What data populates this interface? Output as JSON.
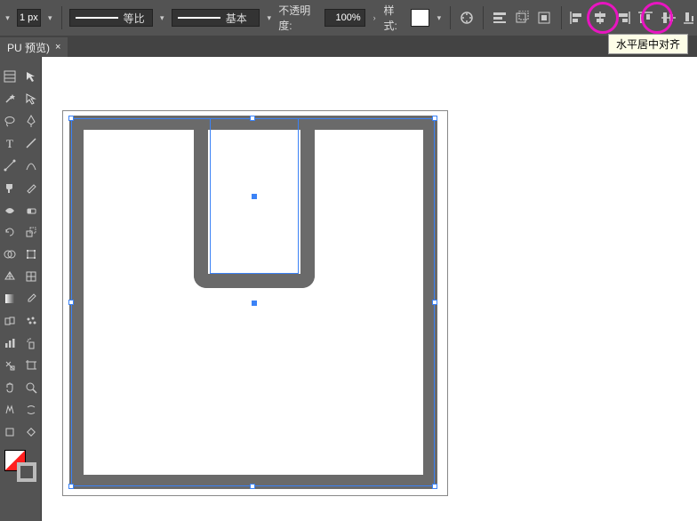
{
  "toolbar": {
    "stroke_value": "1 px",
    "dash_label": "等比",
    "profile_label": "基本",
    "opacity_label": "不透明度:",
    "opacity_value": "100%",
    "style_label": "样式:"
  },
  "tab": {
    "title": "PU 预览)",
    "close": "×"
  },
  "tooltip": {
    "text": "水平居中对齐"
  },
  "tools": [
    "texture",
    "arrow",
    "wand",
    "direct",
    "lasso",
    "pen",
    "type",
    "segment",
    "line",
    "curvature",
    "paint",
    "pencil",
    "width",
    "eraser",
    "rotate",
    "scale",
    "shape-builder",
    "free-transform",
    "perspective",
    "mesh",
    "gradient",
    "eyedrop",
    "blend",
    "symbol",
    "column",
    "spray",
    "slice",
    "artboard",
    "hand",
    "zoom",
    "glyph1",
    "glyph2",
    "square",
    "diamond"
  ],
  "icons": {
    "recolor": "recolor",
    "align_prefs": "align-prefs",
    "transform": "transform",
    "isolate": "isolate",
    "align_left": "align-left",
    "align_hcenter": "align-hcenter",
    "align_right": "align-right",
    "align_top": "align-top",
    "align_vcenter": "align-vcenter",
    "align_bottom": "align-bottom"
  }
}
